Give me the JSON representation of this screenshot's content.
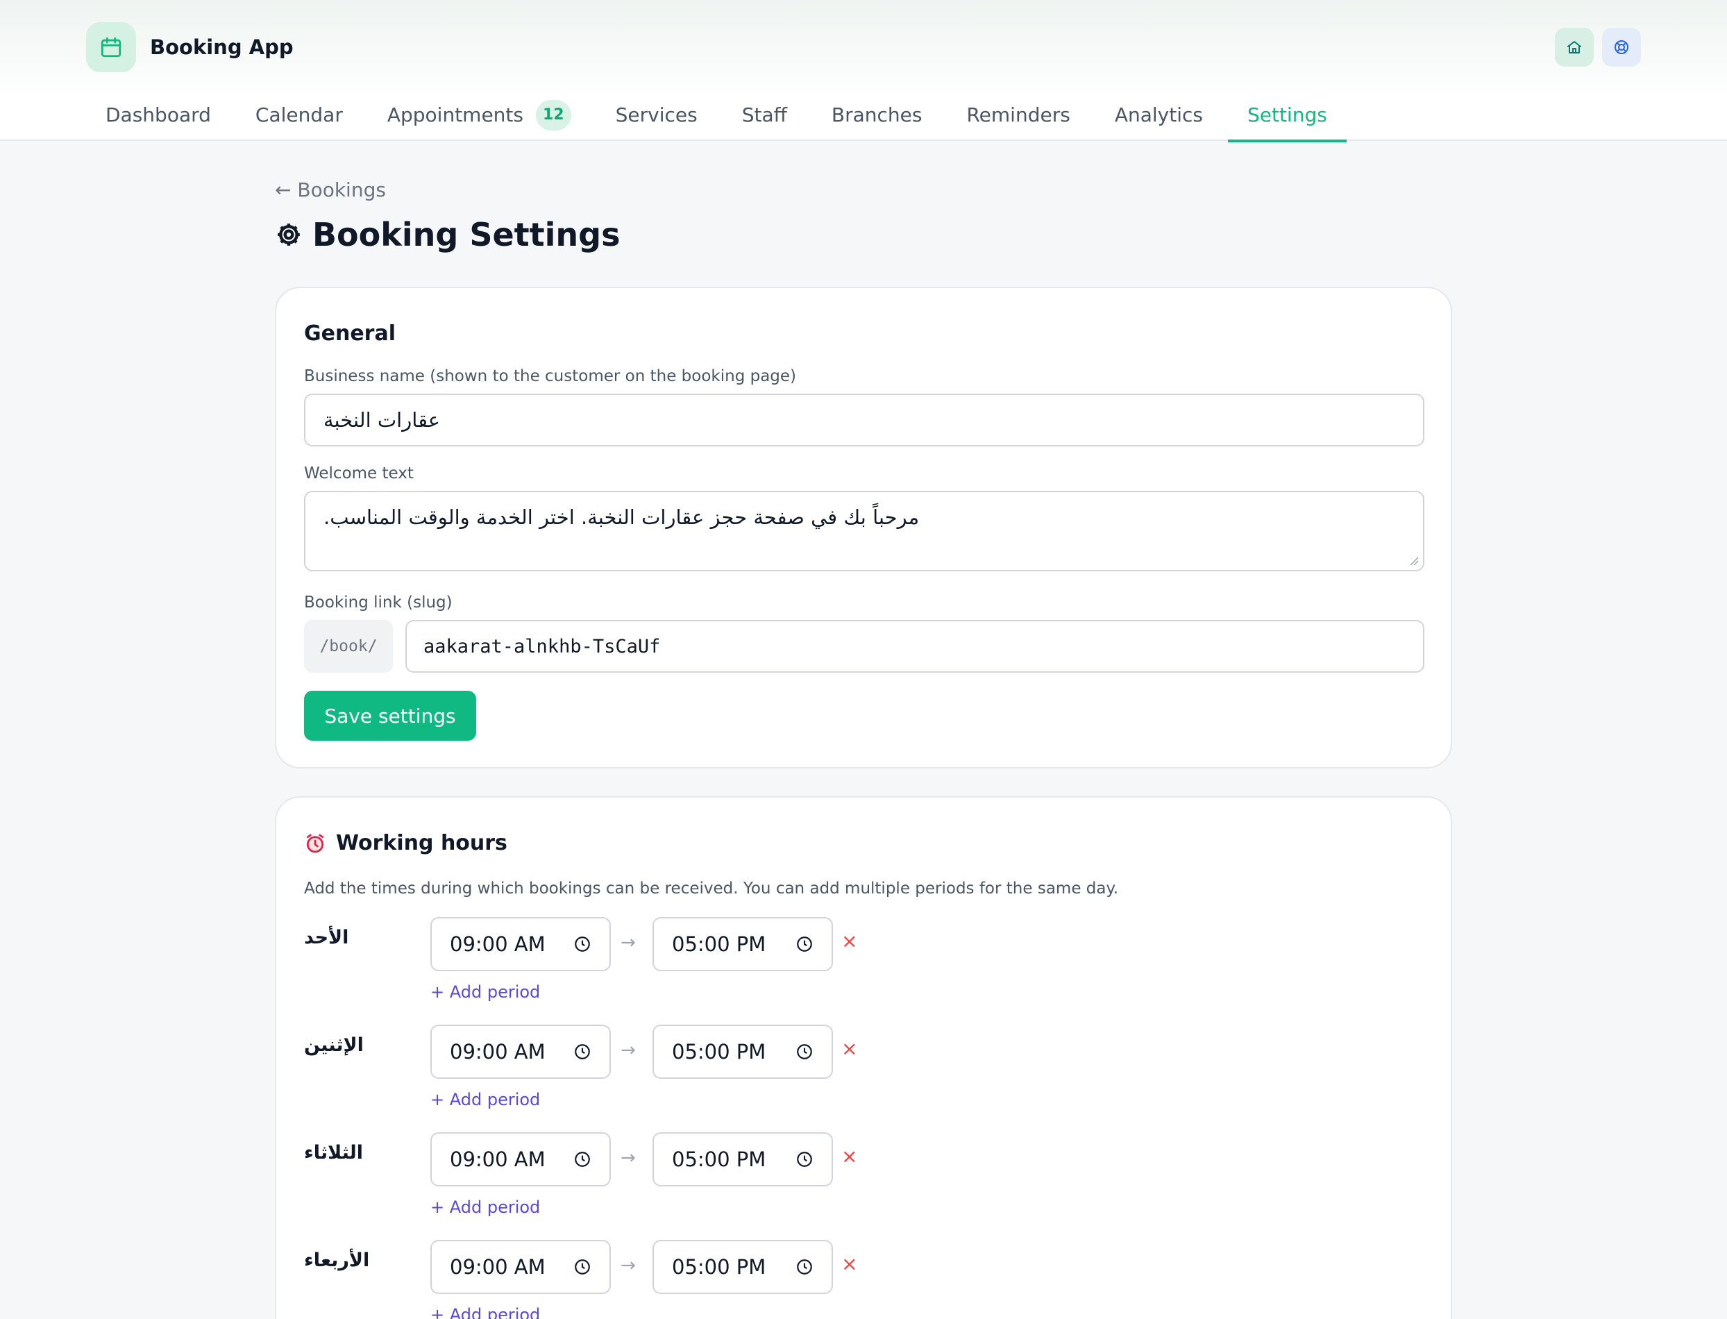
{
  "app": {
    "name": "Booking App"
  },
  "nav": [
    {
      "label": "Dashboard"
    },
    {
      "label": "Calendar"
    },
    {
      "label": "Appointments",
      "badge": "12"
    },
    {
      "label": "Services"
    },
    {
      "label": "Staff"
    },
    {
      "label": "Branches"
    },
    {
      "label": "Reminders"
    },
    {
      "label": "Analytics"
    },
    {
      "label": "Settings",
      "active": true
    }
  ],
  "breadcrumb": {
    "back_label": "← Bookings"
  },
  "page": {
    "title": "Booking Settings"
  },
  "general": {
    "title": "General",
    "business_name_label": "Business name (shown to the customer on the booking page)",
    "business_name_value": "عقارات النخبة",
    "welcome_label": "Welcome text",
    "welcome_value": "مرحباً بك في صفحة حجز عقارات النخبة. اختر الخدمة والوقت المناسب.",
    "slug_label": "Booking link (slug)",
    "slug_prefix": "/book/",
    "slug_value": "aakarat-alnkhb-TsCaUf",
    "save_label": "Save settings"
  },
  "hours": {
    "title": "Working hours",
    "description": "Add the times during which bookings can be received. You can add multiple periods for the same day.",
    "arrow": "→",
    "remove_symbol": "×",
    "add_period_label": "+ Add period",
    "days": [
      {
        "name": "الأحد",
        "start": "09:00 AM",
        "end": "05:00 PM"
      },
      {
        "name": "الإثنين",
        "start": "09:00 AM",
        "end": "05:00 PM"
      },
      {
        "name": "الثلاثاء",
        "start": "09:00 AM",
        "end": "05:00 PM"
      },
      {
        "name": "الأربعاء",
        "start": "09:00 AM",
        "end": "05:00 PM"
      }
    ]
  },
  "colors": {
    "accent": "#10b981",
    "link": "#5b49d6",
    "danger": "#ef4444"
  }
}
